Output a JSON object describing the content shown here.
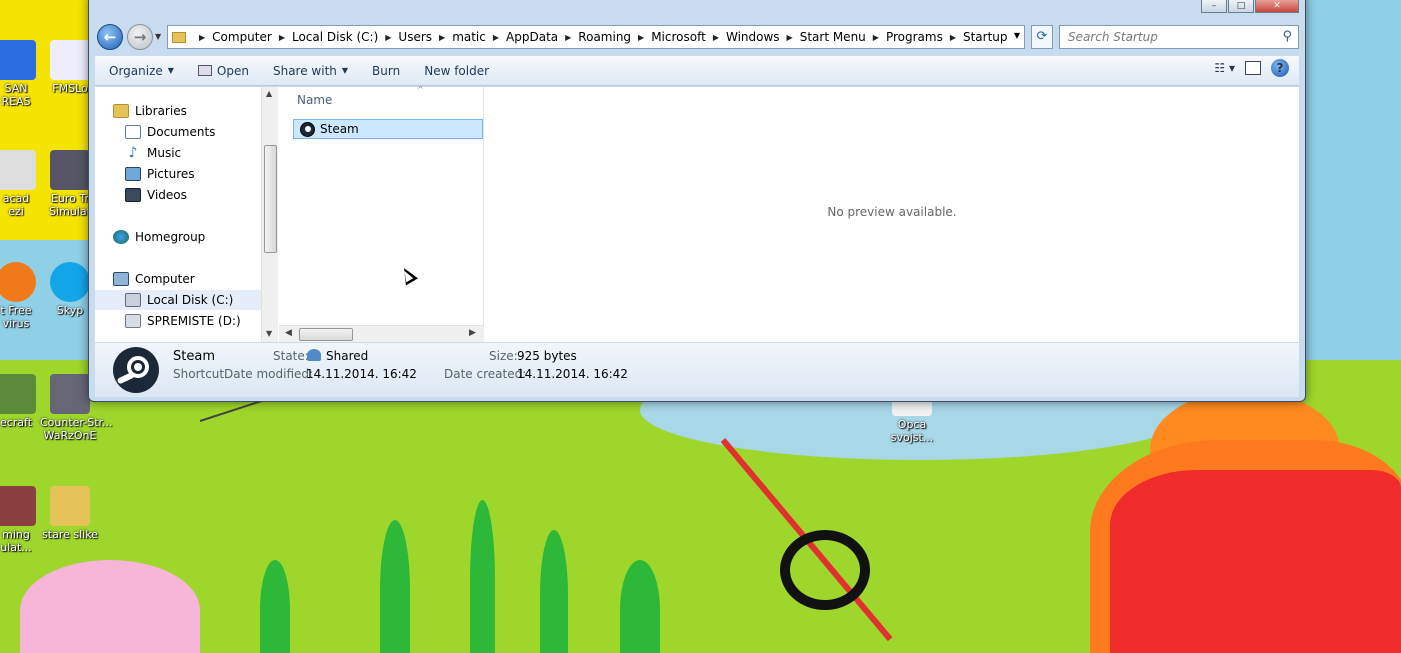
{
  "desktop": {
    "icons": [
      {
        "label": "SAN\nREAS",
        "icon": "game-icon"
      },
      {
        "label": "FMSLo",
        "icon": "file-icon"
      },
      {
        "label": "acad\nezi",
        "icon": "app-icon"
      },
      {
        "label": "Euro Tr\nSimulat",
        "icon": "truck-icon"
      },
      {
        "label": "t Free\nvirus",
        "icon": "antivirus-icon"
      },
      {
        "label": "Skyp",
        "icon": "skype-icon"
      },
      {
        "label": "ecraft",
        "icon": "minecraft-icon"
      },
      {
        "label": "Counter-Str...\nWaRzOnE",
        "icon": "game-icon"
      },
      {
        "label": "ming\nulat...",
        "icon": "tractor-icon"
      },
      {
        "label": "stare slike",
        "icon": "folder-icon"
      },
      {
        "label": "Opca\nsvojst...",
        "icon": "file-icon"
      }
    ]
  },
  "window": {
    "caption": {
      "minimize": "–",
      "maximize": "□",
      "close": "✕"
    }
  },
  "nav": {
    "back_icon": "←",
    "forward_icon": "→",
    "breadcrumb": [
      "Computer",
      "Local Disk (C:)",
      "Users",
      "matic",
      "AppData",
      "Roaming",
      "Microsoft",
      "Windows",
      "Start Menu",
      "Programs",
      "Startup"
    ],
    "refresh_icon": "⟳",
    "search_placeholder": "Search Startup"
  },
  "toolbar": {
    "organize": "Organize",
    "open": "Open",
    "share_with": "Share with",
    "burn": "Burn",
    "new_folder": "New folder",
    "help": "?"
  },
  "navpane": {
    "libraries": "Libraries",
    "documents": "Documents",
    "music": "Music",
    "pictures": "Pictures",
    "videos": "Videos",
    "homegroup": "Homegroup",
    "computer": "Computer",
    "local_disk": "Local Disk (C:)",
    "spremiste": "SPREMISTE (D:)"
  },
  "filepane": {
    "column": "Name",
    "files": [
      {
        "name": "Steam"
      }
    ]
  },
  "preview": {
    "text": "No preview available."
  },
  "details": {
    "name": "Steam",
    "type": "Shortcut",
    "state_label": "State:",
    "state_value": "Shared",
    "modified_label": "Date modified:",
    "modified_value": "14.11.2014. 16:42",
    "size_label": "Size:",
    "size_value": "925 bytes",
    "created_label": "Date created:",
    "created_value": "14.11.2014. 16:42"
  }
}
